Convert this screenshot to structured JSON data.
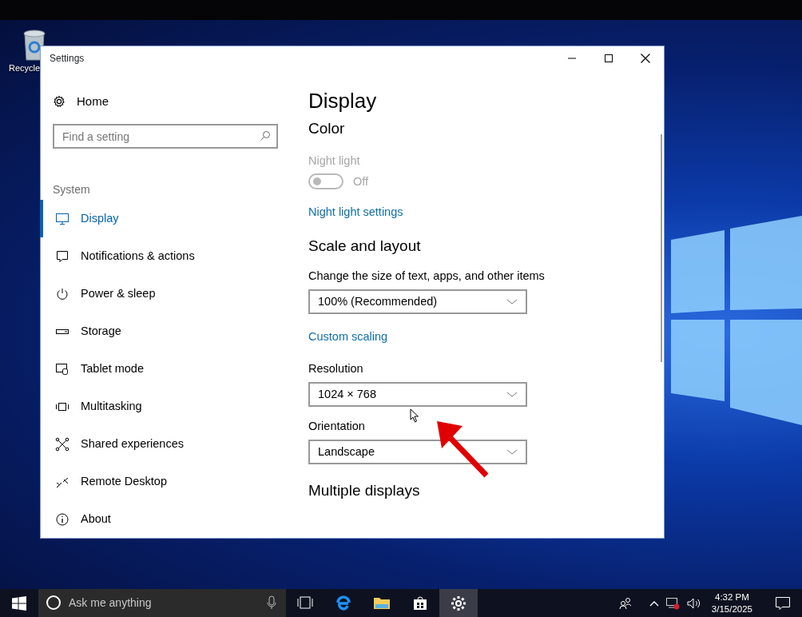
{
  "desktop": {
    "icons": [
      {
        "label": "Recycle"
      }
    ]
  },
  "window": {
    "title": "Settings"
  },
  "sidebar": {
    "home": "Home",
    "search": {
      "placeholder": "Find a setting"
    },
    "section": "System",
    "items": [
      {
        "label": "Display",
        "selected": true
      },
      {
        "label": "Notifications & actions",
        "selected": false
      },
      {
        "label": "Power & sleep",
        "selected": false
      },
      {
        "label": "Storage",
        "selected": false
      },
      {
        "label": "Tablet mode",
        "selected": false
      },
      {
        "label": "Multitasking",
        "selected": false
      },
      {
        "label": "Shared experiences",
        "selected": false
      },
      {
        "label": "Remote Desktop",
        "selected": false
      },
      {
        "label": "About",
        "selected": false
      }
    ]
  },
  "content": {
    "title": "Display",
    "blocks": [
      {
        "kind": "heading",
        "text": "Color"
      },
      {
        "kind": "toggle",
        "label": "Night light",
        "on": false,
        "disabled": true,
        "state_text": "Off"
      },
      {
        "kind": "link",
        "text": "Night light settings"
      },
      {
        "kind": "heading",
        "text": "Scale and layout"
      },
      {
        "kind": "dropdown",
        "label": "Change the size of text, apps, and other items",
        "value": "100% (Recommended)"
      },
      {
        "kind": "link",
        "text": "Custom scaling"
      },
      {
        "kind": "dropdown",
        "label": "Resolution",
        "value": "1024 × 768"
      },
      {
        "kind": "dropdown",
        "label": "Orientation",
        "value": "Landscape"
      },
      {
        "kind": "heading",
        "text": "Multiple displays"
      }
    ]
  },
  "taskbar": {
    "search": {
      "placeholder": "Ask me anything"
    },
    "apps": [
      {
        "selected": false
      },
      {
        "selected": false
      },
      {
        "selected": false
      },
      {
        "selected": false
      },
      {
        "selected": true
      }
    ],
    "clock": {
      "time": "4:32 PM",
      "date": "3/15/2025"
    }
  }
}
